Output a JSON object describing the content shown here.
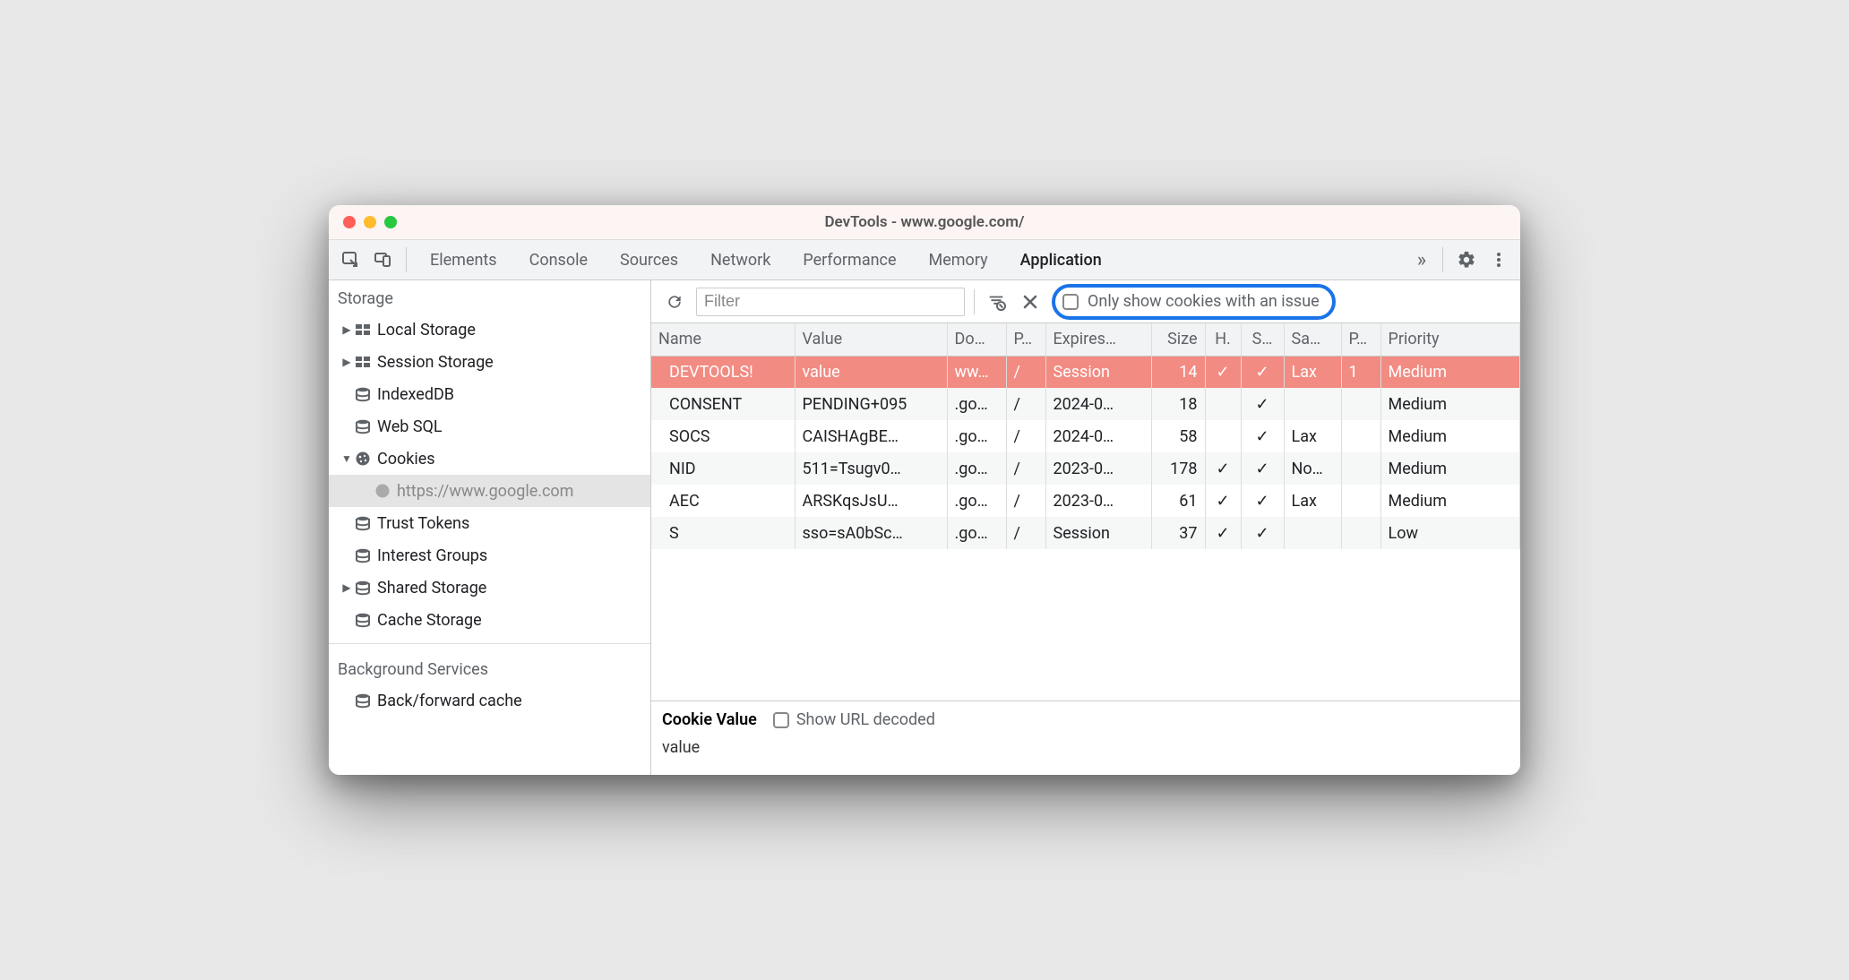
{
  "window_title": "DevTools - www.google.com/",
  "tabs": {
    "items": [
      "Elements",
      "Console",
      "Sources",
      "Network",
      "Performance",
      "Memory",
      "Application"
    ],
    "active": "Application"
  },
  "sidebar": {
    "storage_heading": "Storage",
    "items": [
      {
        "label": "Local Storage",
        "icon": "grid",
        "expandable": true,
        "expanded": false,
        "depth": 1
      },
      {
        "label": "Session Storage",
        "icon": "grid",
        "expandable": true,
        "expanded": false,
        "depth": 1
      },
      {
        "label": "IndexedDB",
        "icon": "db",
        "expandable": false,
        "depth": 1
      },
      {
        "label": "Web SQL",
        "icon": "db",
        "expandable": false,
        "depth": 1
      },
      {
        "label": "Cookies",
        "icon": "cookie",
        "expandable": true,
        "expanded": true,
        "depth": 1
      },
      {
        "label": "https://www.google.com",
        "icon": "cookie",
        "expandable": false,
        "depth": 2,
        "selected": true,
        "dim": true
      },
      {
        "label": "Trust Tokens",
        "icon": "db",
        "expandable": false,
        "depth": 1
      },
      {
        "label": "Interest Groups",
        "icon": "db",
        "expandable": false,
        "depth": 1
      },
      {
        "label": "Shared Storage",
        "icon": "db",
        "expandable": true,
        "expanded": false,
        "depth": 1
      },
      {
        "label": "Cache Storage",
        "icon": "db",
        "expandable": false,
        "depth": 1
      }
    ],
    "bg_heading": "Background Services",
    "bg_items": [
      {
        "label": "Back/forward cache",
        "icon": "db",
        "depth": 1
      }
    ]
  },
  "toolbar": {
    "filter_placeholder": "Filter",
    "issue_label": "Only show cookies with an issue"
  },
  "table": {
    "headers": [
      "Name",
      "Value",
      "Do…",
      "P…",
      "Expires…",
      "Size",
      "H.",
      "S…",
      "Sa…",
      "P…",
      "Priority"
    ],
    "rows": [
      {
        "name": "DEVTOOLS!",
        "value": "value",
        "domain": "ww…",
        "path": "/",
        "expires": "Session",
        "size": "14",
        "http": "✓",
        "secure": "✓",
        "same": "Lax",
        "part": "1",
        "priority": "Medium",
        "selected": true
      },
      {
        "name": "CONSENT",
        "value": "PENDING+095",
        "domain": ".go…",
        "path": "/",
        "expires": "2024-0…",
        "size": "18",
        "http": "",
        "secure": "✓",
        "same": "",
        "part": "",
        "priority": "Medium"
      },
      {
        "name": "SOCS",
        "value": "CAISHAgBE…",
        "domain": ".go…",
        "path": "/",
        "expires": "2024-0…",
        "size": "58",
        "http": "",
        "secure": "✓",
        "same": "Lax",
        "part": "",
        "priority": "Medium"
      },
      {
        "name": "NID",
        "value": "511=Tsugv0…",
        "domain": ".go…",
        "path": "/",
        "expires": "2023-0…",
        "size": "178",
        "http": "✓",
        "secure": "✓",
        "same": "No…",
        "part": "",
        "priority": "Medium"
      },
      {
        "name": "AEC",
        "value": "ARSKqsJsU…",
        "domain": ".go…",
        "path": "/",
        "expires": "2023-0…",
        "size": "61",
        "http": "✓",
        "secure": "✓",
        "same": "Lax",
        "part": "",
        "priority": "Medium"
      },
      {
        "name": "S",
        "value": "sso=sA0bSc…",
        "domain": ".go…",
        "path": "/",
        "expires": "Session",
        "size": "37",
        "http": "✓",
        "secure": "✓",
        "same": "",
        "part": "",
        "priority": "Low"
      }
    ]
  },
  "detail": {
    "heading": "Cookie Value",
    "option": "Show URL decoded",
    "value": "value"
  }
}
